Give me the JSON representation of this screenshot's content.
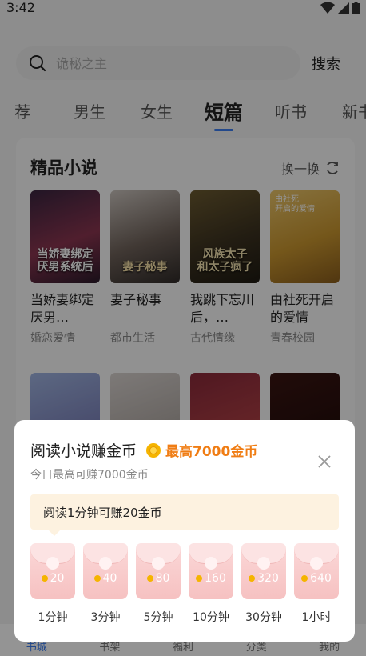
{
  "status": {
    "time": "3:42"
  },
  "search": {
    "placeholder": "诡秘之主",
    "button": "搜索"
  },
  "tabs": [
    "荐",
    "男生",
    "女生",
    "短篇",
    "听书",
    "新书"
  ],
  "section": {
    "title": "精品小说",
    "refresh": "换一换"
  },
  "books": [
    {
      "name": "当娇妻绑定厌男…",
      "category": "婚恋爱情",
      "cover_text": "当娇妻绑定\n厌男系统后"
    },
    {
      "name": "妻子秘事",
      "category": "都市生活",
      "cover_text": "妻子秘事"
    },
    {
      "name": "我跳下忘川后，…",
      "category": "古代情缘",
      "cover_text": "风族太子\n和太子疯了"
    },
    {
      "name": "由社死开启的爱情",
      "category": "青春校园",
      "cover_text": "由社死\n开启的爱情"
    }
  ],
  "bottom_nav": [
    "书城",
    "书架",
    "福利",
    "分类",
    "我的"
  ],
  "dialog": {
    "title": "阅读小说赚金币",
    "highlight": "最高7000金币",
    "subtitle": "今日最高可赚7000金币",
    "tip": "阅读1分钟可赚20金币",
    "rewards": [
      {
        "amount": "20",
        "label": "1分钟"
      },
      {
        "amount": "40",
        "label": "3分钟"
      },
      {
        "amount": "80",
        "label": "5分钟"
      },
      {
        "amount": "160",
        "label": "10分钟"
      },
      {
        "amount": "320",
        "label": "30分钟"
      },
      {
        "amount": "640",
        "label": "1小时"
      }
    ]
  }
}
